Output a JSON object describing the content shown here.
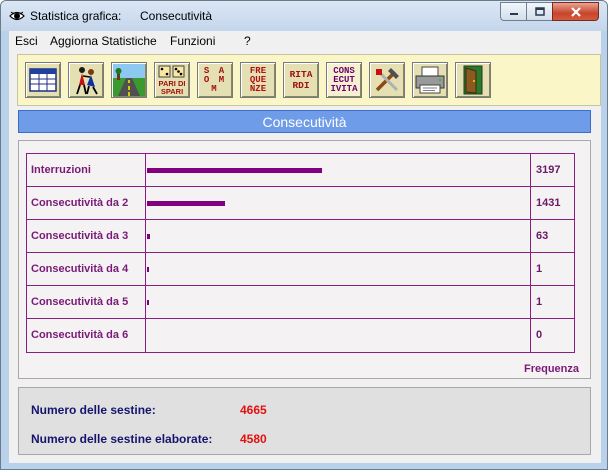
{
  "window": {
    "title": "Statistica grafica:",
    "subtitle": "Consecutività",
    "accent": "#6f9ce8"
  },
  "menu": [
    "Esci",
    "Aggiorna Statistiche",
    "Funzioni",
    "?"
  ],
  "toolbar": {
    "buttons": [
      {
        "icon": "table-icon"
      },
      {
        "icon": "dancers-icon"
      },
      {
        "icon": "road-icon"
      },
      {
        "icon": "pari-dispari-icon",
        "label_lines": [
          "PARI DI",
          "SPARI"
        ]
      },
      {
        "icon": "somma-icon",
        "label_lines": [
          "S A",
          "O M",
          "M"
        ]
      },
      {
        "icon": "frequenze-icon",
        "label_lines": [
          "FRE",
          "QUE",
          "NZE"
        ]
      },
      {
        "icon": "ritardi-icon",
        "label_lines": [
          "RITA",
          "RDI"
        ]
      },
      {
        "icon": "consecutivita-icon",
        "label_lines": [
          "CONS",
          "ECUT",
          "IVITA"
        ]
      },
      {
        "icon": "tools-icon"
      },
      {
        "icon": "printer-icon"
      },
      {
        "icon": "exit-door-icon"
      }
    ]
  },
  "section_title": "Consecutività",
  "chart_data": {
    "type": "bar",
    "categories": [
      "Interruzioni",
      "Consecutività da 2",
      "Consecutività da 3",
      "Consecutività da 4",
      "Consecutività da 5",
      "Consecutività da 6"
    ],
    "values": [
      3197,
      1431,
      63,
      1,
      1,
      0
    ],
    "xlabel": "Frequenza",
    "xlim": [
      0,
      7000
    ],
    "bar_color": "#800080"
  },
  "info": {
    "sestine_label": "Numero delle sestine:",
    "sestine_value": "4665",
    "elaborate_label": "Numero delle sestine elaborate:",
    "elaborate_value": "4580"
  }
}
